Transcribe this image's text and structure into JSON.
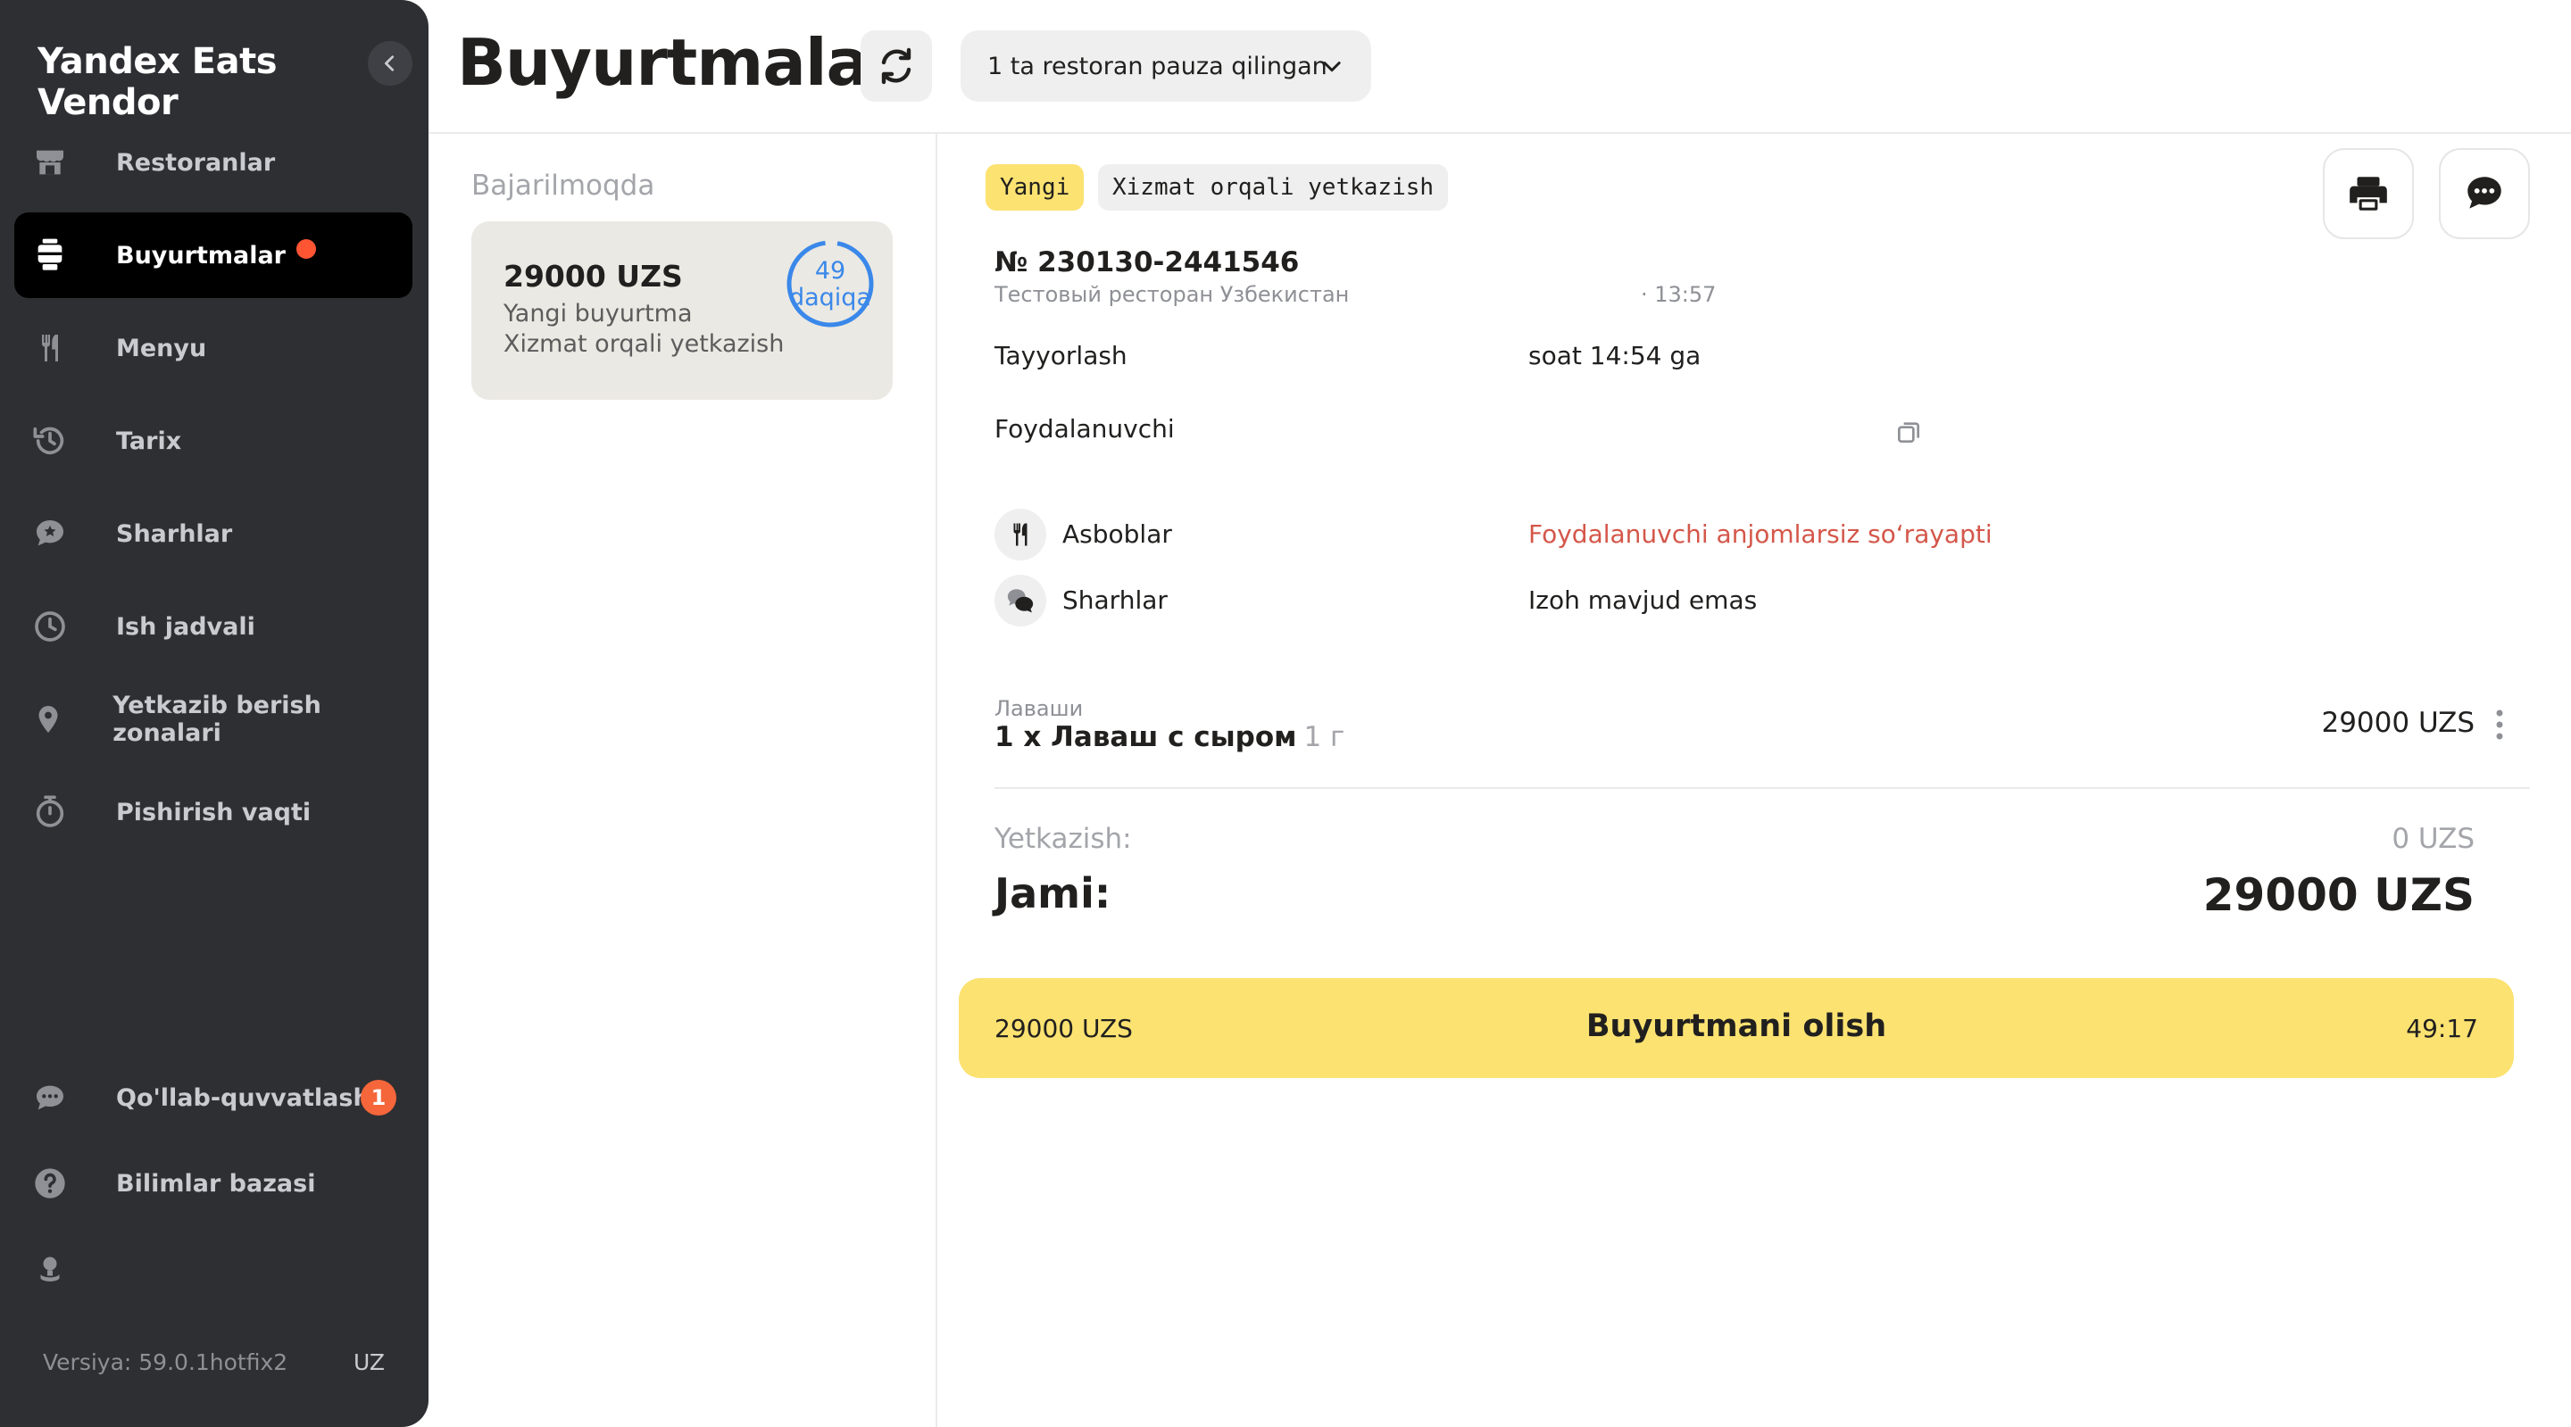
{
  "app": {
    "title": "Yandex Eats Vendor"
  },
  "sidebar": {
    "items": [
      {
        "label": "Restoranlar",
        "icon": "store-icon"
      },
      {
        "label": "Buyurtmalar",
        "icon": "orders-icon",
        "active": true,
        "has_dot": true
      },
      {
        "label": "Menyu",
        "icon": "fork-knife-icon"
      },
      {
        "label": "Tarix",
        "icon": "history-icon"
      },
      {
        "label": "Sharhlar",
        "icon": "reviews-icon"
      },
      {
        "label": "Ish jadvali",
        "icon": "clock-icon"
      },
      {
        "label": "Yetkazib berish zonalari",
        "icon": "location-pin-icon"
      },
      {
        "label": "Pishirish vaqti",
        "icon": "stopwatch-icon"
      }
    ],
    "bottom_items": [
      {
        "label": "Qo'llab-quvvatlash",
        "icon": "support-chat-icon",
        "badge": "1"
      },
      {
        "label": "Bilimlar bazasi",
        "icon": "help-icon"
      }
    ],
    "version": "Versiya: 59.0.1hotfix2",
    "language": "UZ"
  },
  "header": {
    "title": "Buyurtmalar",
    "pause_dropdown": "1 ta restoran pauza qilingan"
  },
  "orders_list": {
    "section_title": "Bajarilmoqda",
    "card": {
      "price": "29000 UZS",
      "status": "Yangi buyurtma",
      "delivery_type": "Xizmat orqali yetkazish",
      "timer_value": "49",
      "timer_unit": "daqiqa"
    }
  },
  "order_detail": {
    "tags": {
      "status": "Yangi",
      "delivery": "Xizmat orqali yetkazish"
    },
    "number": "№ 230130-2441546",
    "restaurant": "Тестовый ресторан Узбекистан",
    "time": "· 13:57",
    "prepare_label": "Tayyorlash",
    "prepare_value": "soat 14:54 ga",
    "customer_label": "Foydalanuvchi",
    "tools_label": "Asboblar",
    "tools_value": "Foydalanuvchi anjomlarsiz so‘rayapti",
    "comments_label": "Sharhlar",
    "comments_value": "Izoh mavjud emas",
    "item": {
      "category": "Лаваши",
      "name": "1 x Лаваш с сыром",
      "weight": "1 г",
      "price": "29000 UZS"
    },
    "delivery_label": "Yetkazish:",
    "delivery_value": "0 UZS",
    "total_label": "Jami:",
    "total_value": "29000 UZS",
    "accept": {
      "price": "29000 UZS",
      "label": "Buyurtmani olish",
      "timer": "49:17"
    }
  },
  "colors": {
    "accent_yellow": "#fce271",
    "sidebar_bg": "#2e2f33",
    "warn_red": "#d4574a",
    "timer_blue": "#3a88ea"
  }
}
